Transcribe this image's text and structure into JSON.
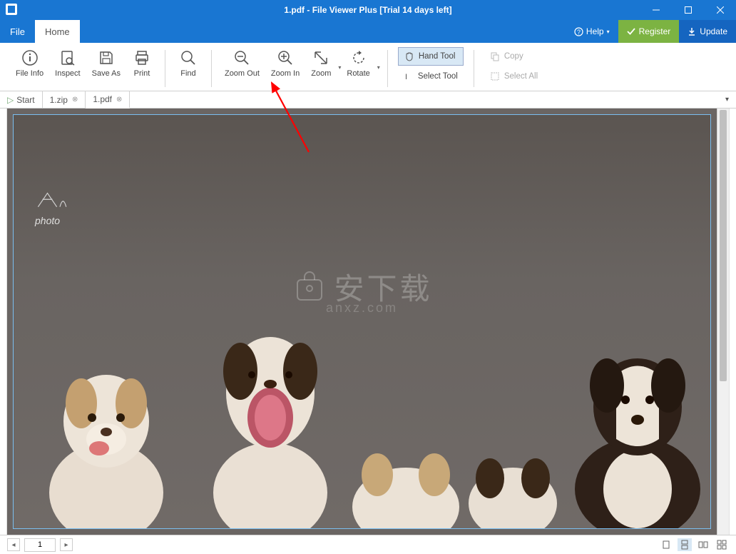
{
  "titlebar": {
    "title": "1.pdf - File Viewer Plus [Trial 14 days left]"
  },
  "menubar": {
    "tabs": [
      {
        "label": "File",
        "active": false
      },
      {
        "label": "Home",
        "active": true
      }
    ],
    "help_label": "Help",
    "register_label": "Register",
    "update_label": "Update"
  },
  "ribbon": {
    "file_info": "File Info",
    "inspect": "Inspect",
    "save_as": "Save As",
    "print": "Print",
    "find": "Find",
    "zoom_out": "Zoom Out",
    "zoom_in": "Zoom In",
    "zoom": "Zoom",
    "rotate": "Rotate",
    "hand_tool": "Hand Tool",
    "select_tool": "Select Tool",
    "copy": "Copy",
    "select_all": "Select All"
  },
  "tabbar": {
    "start_label": "Start",
    "tabs": [
      {
        "label": "1.zip",
        "active": false
      },
      {
        "label": "1.pdf",
        "active": true
      }
    ]
  },
  "statusbar": {
    "page_value": "1"
  },
  "content": {
    "watermark_main": "安下载",
    "watermark_sub": "anxz.com",
    "signature": "photo"
  }
}
